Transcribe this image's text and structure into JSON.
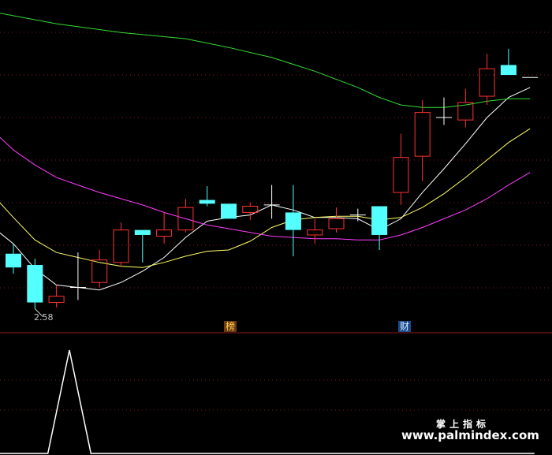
{
  "chart_data": [
    {
      "type": "candlestick",
      "title": "",
      "grid": true,
      "annotations": {
        "min_price": "2.58",
        "tag_a": "榜",
        "tag_b": "财"
      },
      "ylim": [
        2.45,
        5.1
      ],
      "x": [
        1,
        2,
        3,
        4,
        5,
        6,
        7,
        8,
        9,
        10,
        11,
        12,
        13,
        14,
        15,
        16,
        17,
        18,
        19,
        20,
        21,
        22,
        23,
        24,
        25
      ],
      "candles": [
        {
          "x": 1,
          "open": 3.07,
          "high": 3.15,
          "low": 2.91,
          "close": 2.96,
          "color": "cyan"
        },
        {
          "x": 2,
          "open": 2.98,
          "high": 3.03,
          "low": 2.63,
          "close": 2.68,
          "color": "cyan"
        },
        {
          "x": 3,
          "open": 2.68,
          "high": 2.82,
          "low": 2.64,
          "close": 2.73,
          "color": "red"
        },
        {
          "x": 4,
          "open": 2.8,
          "high": 3.08,
          "low": 2.7,
          "close": 2.8,
          "color": "white"
        },
        {
          "x": 5,
          "open": 2.84,
          "high": 3.1,
          "low": 2.8,
          "close": 3.02,
          "color": "red"
        },
        {
          "x": 6,
          "open": 3.0,
          "high": 3.32,
          "low": 2.97,
          "close": 3.26,
          "color": "red"
        },
        {
          "x": 7,
          "open": 3.26,
          "high": 3.26,
          "low": 3.0,
          "close": 3.22,
          "color": "cyan"
        },
        {
          "x": 8,
          "open": 3.21,
          "high": 3.4,
          "low": 3.15,
          "close": 3.26,
          "color": "red"
        },
        {
          "x": 9,
          "open": 3.26,
          "high": 3.51,
          "low": 3.24,
          "close": 3.44,
          "color": "red"
        },
        {
          "x": 10,
          "open": 3.5,
          "high": 3.61,
          "low": 3.45,
          "close": 3.47,
          "color": "cyan"
        },
        {
          "x": 11,
          "open": 3.47,
          "high": 3.47,
          "low": 3.35,
          "close": 3.35,
          "color": "cyan"
        },
        {
          "x": 12,
          "open": 3.4,
          "high": 3.48,
          "low": 3.34,
          "close": 3.45,
          "color": "red"
        },
        {
          "x": 13,
          "open": 3.46,
          "high": 3.62,
          "low": 3.35,
          "close": 3.46,
          "color": "white"
        },
        {
          "x": 14,
          "open": 3.4,
          "high": 3.62,
          "low": 3.05,
          "close": 3.26,
          "color": "cyan"
        },
        {
          "x": 15,
          "open": 3.22,
          "high": 3.35,
          "low": 3.15,
          "close": 3.26,
          "color": "red"
        },
        {
          "x": 16,
          "open": 3.27,
          "high": 3.44,
          "low": 3.24,
          "close": 3.35,
          "color": "red"
        },
        {
          "x": 17,
          "open": 3.38,
          "high": 3.43,
          "low": 3.33,
          "close": 3.38,
          "color": "white"
        },
        {
          "x": 18,
          "open": 3.45,
          "high": 3.45,
          "low": 3.1,
          "close": 3.22,
          "color": "cyan"
        },
        {
          "x": 19,
          "open": 3.56,
          "high": 4.03,
          "low": 3.46,
          "close": 3.84,
          "color": "red"
        },
        {
          "x": 20,
          "open": 3.85,
          "high": 4.3,
          "low": 3.65,
          "close": 4.2,
          "color": "red"
        },
        {
          "x": 21,
          "open": 4.16,
          "high": 4.32,
          "low": 4.1,
          "close": 4.16,
          "color": "white"
        },
        {
          "x": 22,
          "open": 4.14,
          "high": 4.39,
          "low": 4.08,
          "close": 4.28,
          "color": "red"
        },
        {
          "x": 23,
          "open": 4.33,
          "high": 4.67,
          "low": 4.26,
          "close": 4.55,
          "color": "red"
        },
        {
          "x": 24,
          "open": 4.58,
          "high": 4.71,
          "low": 4.51,
          "close": 4.5,
          "color": "cyan"
        },
        {
          "x": 25,
          "open": 4.48,
          "high": 4.48,
          "low": 4.48,
          "close": 4.48,
          "color": "white"
        }
      ],
      "series": [
        {
          "color": "#ffffff",
          "values": [
            [
              0.2,
              3.26
            ],
            [
              1,
              3.15
            ],
            [
              2,
              2.95
            ],
            [
              3,
              2.82
            ],
            [
              4,
              2.8
            ],
            [
              5,
              2.78
            ],
            [
              6,
              2.84
            ],
            [
              7,
              2.93
            ],
            [
              8,
              3.04
            ],
            [
              9,
              3.2
            ],
            [
              10,
              3.33
            ],
            [
              11,
              3.36
            ],
            [
              12,
              3.38
            ],
            [
              13,
              3.46
            ],
            [
              14,
              3.42
            ],
            [
              15,
              3.36
            ],
            [
              16,
              3.36
            ],
            [
              17,
              3.35
            ],
            [
              18,
              3.26
            ],
            [
              19,
              3.35
            ],
            [
              20,
              3.56
            ],
            [
              21,
              3.75
            ],
            [
              22,
              3.95
            ],
            [
              23,
              4.16
            ],
            [
              24,
              4.32
            ],
            [
              25,
              4.4
            ]
          ]
        },
        {
          "color": "#ffff66",
          "values": [
            [
              0.2,
              3.51
            ],
            [
              1,
              3.36
            ],
            [
              2,
              3.18
            ],
            [
              3,
              3.08
            ],
            [
              4,
              3.04
            ],
            [
              5,
              3.0
            ],
            [
              6,
              2.97
            ],
            [
              7,
              2.96
            ],
            [
              8,
              3.0
            ],
            [
              9,
              3.05
            ],
            [
              10,
              3.09
            ],
            [
              11,
              3.1
            ],
            [
              12,
              3.17
            ],
            [
              13,
              3.28
            ],
            [
              14,
              3.34
            ],
            [
              15,
              3.36
            ],
            [
              16,
              3.37
            ],
            [
              17,
              3.37
            ],
            [
              18,
              3.34
            ],
            [
              19,
              3.36
            ],
            [
              20,
              3.44
            ],
            [
              21,
              3.55
            ],
            [
              22,
              3.68
            ],
            [
              23,
              3.82
            ],
            [
              24,
              3.96
            ],
            [
              25,
              4.07
            ]
          ]
        },
        {
          "color": "#ff3dff",
          "values": [
            [
              0.2,
              4.03
            ],
            [
              1,
              3.9
            ],
            [
              2,
              3.78
            ],
            [
              3,
              3.68
            ],
            [
              4,
              3.62
            ],
            [
              5,
              3.56
            ],
            [
              6,
              3.51
            ],
            [
              7,
              3.46
            ],
            [
              8,
              3.4
            ],
            [
              9,
              3.35
            ],
            [
              10,
              3.3
            ],
            [
              11,
              3.27
            ],
            [
              12,
              3.24
            ],
            [
              13,
              3.21
            ],
            [
              14,
              3.2
            ],
            [
              15,
              3.19
            ],
            [
              16,
              3.19
            ],
            [
              17,
              3.18
            ],
            [
              18,
              3.18
            ],
            [
              19,
              3.22
            ],
            [
              20,
              3.28
            ],
            [
              21,
              3.35
            ],
            [
              22,
              3.42
            ],
            [
              23,
              3.51
            ],
            [
              24,
              3.62
            ],
            [
              25,
              3.72
            ]
          ]
        },
        {
          "color": "#33dd33",
          "values": [
            [
              0.2,
              5.0
            ],
            [
              3,
              4.91
            ],
            [
              6,
              4.84
            ],
            [
              9,
              4.79
            ],
            [
              11,
              4.72
            ],
            [
              13,
              4.64
            ],
            [
              15,
              4.53
            ],
            [
              17,
              4.4
            ],
            [
              18,
              4.32
            ],
            [
              19,
              4.26
            ],
            [
              20,
              4.24
            ],
            [
              21,
              4.24
            ],
            [
              22,
              4.26
            ],
            [
              23,
              4.29
            ],
            [
              24,
              4.31
            ],
            [
              25,
              4.31
            ]
          ]
        }
      ]
    },
    {
      "type": "line",
      "title": "",
      "grid": true,
      "ylim": [
        0,
        1
      ],
      "x": [
        1,
        2,
        3,
        4,
        5,
        6,
        7,
        8,
        9,
        10,
        11,
        12,
        13,
        14,
        15,
        16,
        17,
        18,
        19,
        20,
        21,
        22,
        23,
        24,
        25
      ],
      "series": [
        {
          "color": "#ffffff",
          "values": [
            [
              0.2,
              0
            ],
            [
              2.6,
              0
            ],
            [
              3.6,
              1
            ],
            [
              4.6,
              0
            ],
            [
              25.2,
              0
            ]
          ]
        }
      ]
    }
  ],
  "watermark": {
    "cn": "掌上指标",
    "url": "www.palmindex.com"
  }
}
